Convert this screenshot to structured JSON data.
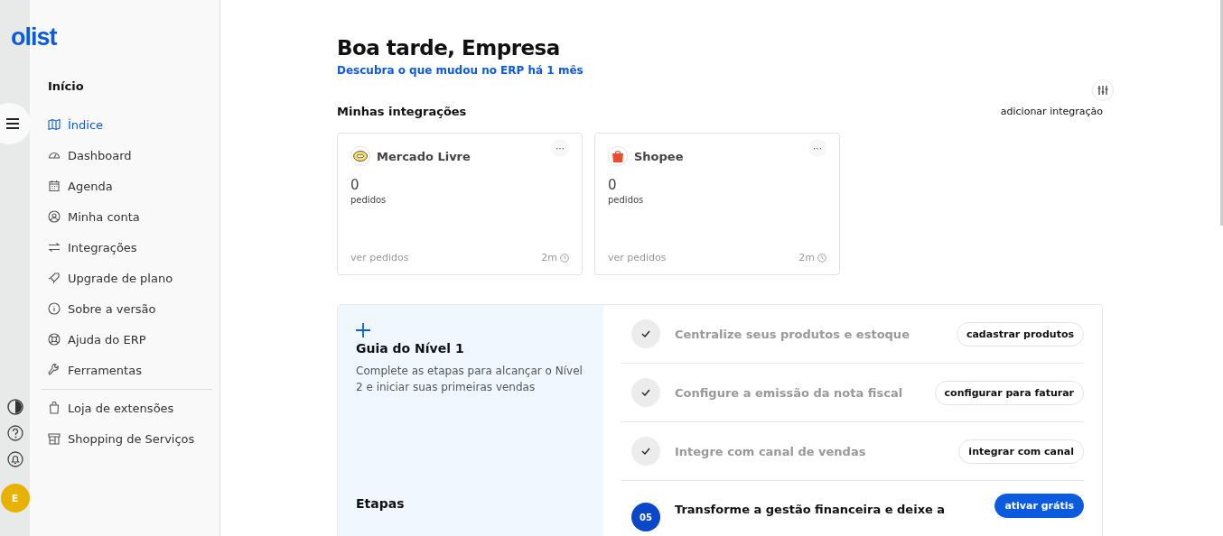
{
  "brand": "olist",
  "rail": {
    "avatar": "E"
  },
  "sidebar": {
    "section": "Início",
    "items": [
      {
        "label": "Índice",
        "selected": true
      },
      {
        "label": "Dashboard",
        "selected": false
      },
      {
        "label": "Agenda",
        "selected": false
      },
      {
        "label": "Minha conta",
        "selected": false
      },
      {
        "label": "Integrações",
        "selected": false
      },
      {
        "label": "Upgrade de plano",
        "selected": false
      },
      {
        "label": "Sobre a versão",
        "selected": false
      },
      {
        "label": "Ajuda do ERP",
        "selected": false
      },
      {
        "label": "Ferramentas",
        "selected": false
      }
    ],
    "extra_items": [
      {
        "label": "Loja de extensões",
        "selected": false
      },
      {
        "label": "Shopping de Serviços",
        "selected": false
      }
    ]
  },
  "greeting": {
    "title": "Boa tarde, Empresa",
    "link": "Descubra o que mudou no ERP há 1 mês"
  },
  "integrations": {
    "title": "Minhas integrações",
    "add": "adicionar integração",
    "cards": [
      {
        "name": "Mercado Livre",
        "kind": "mercadolivre",
        "more": "···",
        "count": "0",
        "unit": "pedidos",
        "link": "ver pedidos",
        "time": "2m"
      },
      {
        "name": "Shopee",
        "kind": "shopee",
        "more": "···",
        "count": "0",
        "unit": "pedidos",
        "link": "ver pedidos",
        "time": "2m"
      }
    ]
  },
  "guide": {
    "title": "Guia do Nível 1",
    "description": "Complete as etapas para alcançar o Nível 2 e iniciar suas primeiras vendas",
    "steps_title": "Etapas",
    "steps": [
      {
        "kind": "done",
        "text": "Centralize seus produtos e estoque",
        "action": "cadastrar produtos"
      },
      {
        "kind": "done",
        "text": "Configure a emissão da nota fiscal",
        "action": "configurar para faturar"
      },
      {
        "kind": "done",
        "text": "Integre com canal de vendas",
        "action": "integrar com canal"
      },
      {
        "kind": "numbered",
        "number": "05",
        "text": "Transforme a gestão financeira e deixe a",
        "action": "ativar grátis"
      }
    ]
  }
}
